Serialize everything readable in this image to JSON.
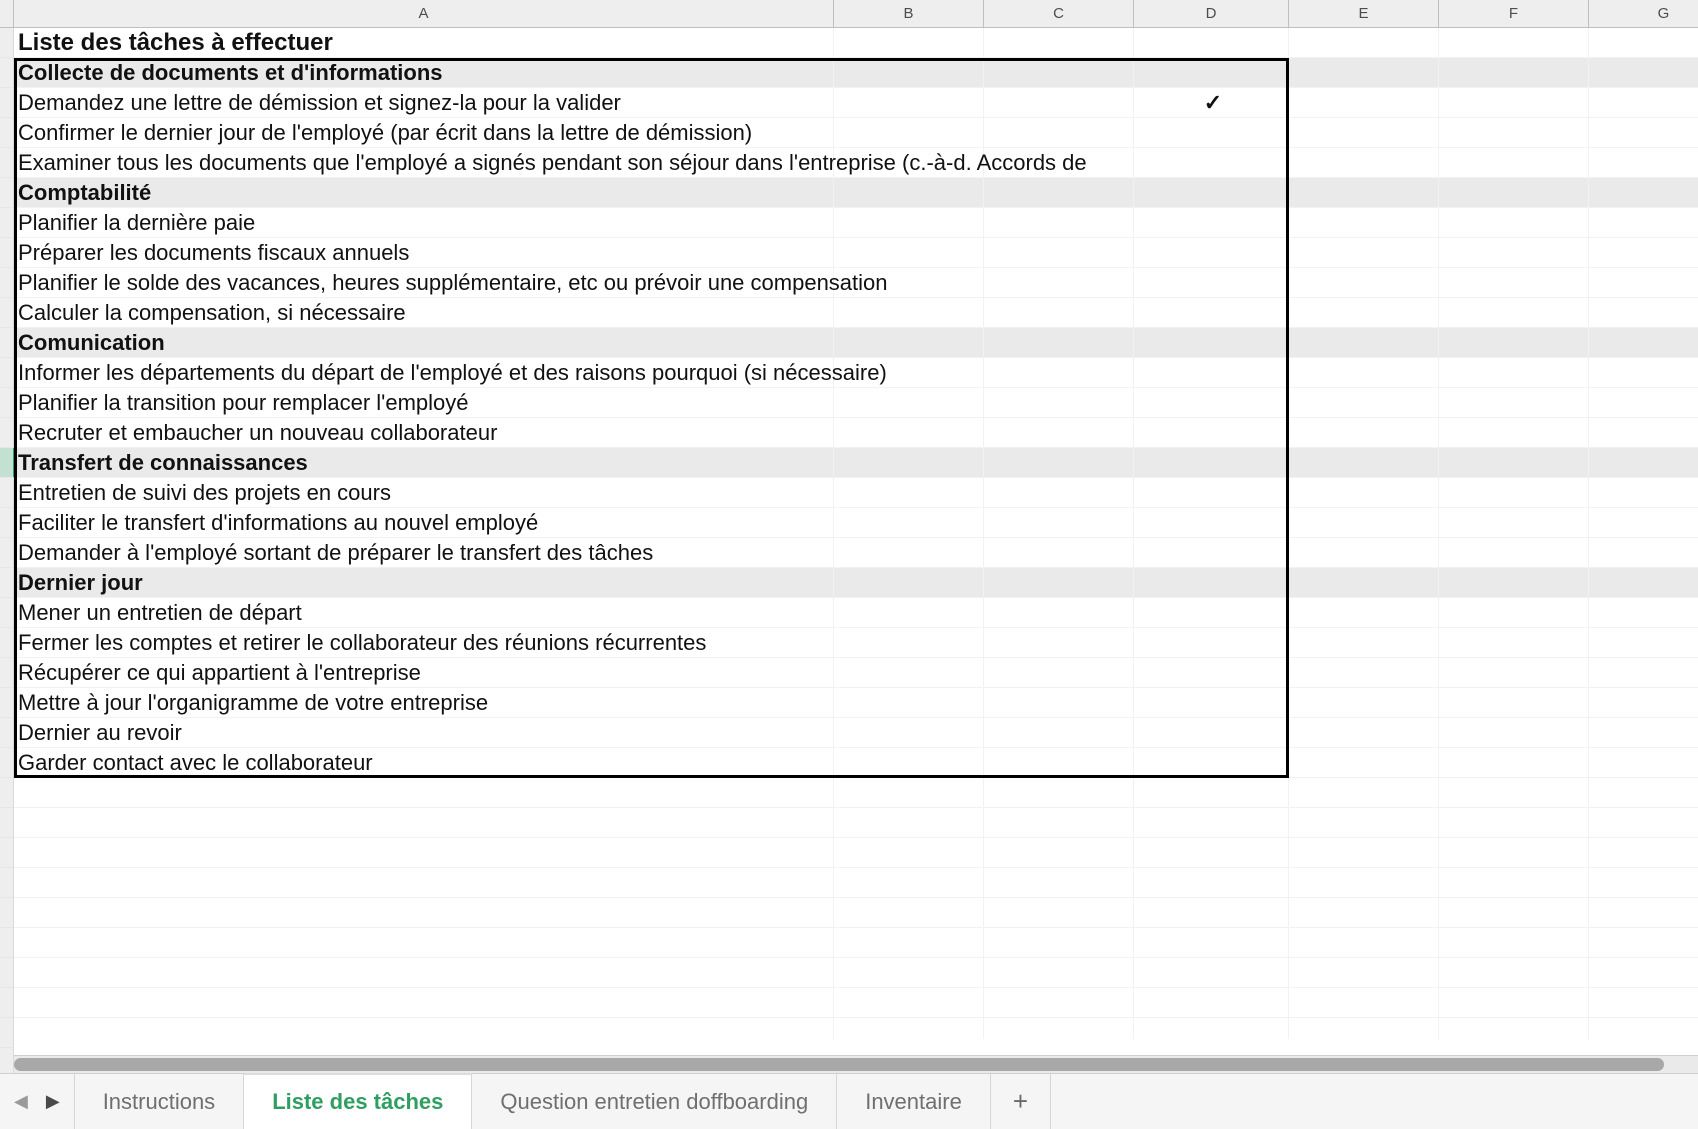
{
  "columns": [
    "A",
    "B",
    "C",
    "D",
    "E",
    "F",
    "G"
  ],
  "title": "Liste des tâches à effectuer",
  "checkmark_glyph": "✓",
  "sections": [
    {
      "heading": "Collecte de documents et d'informations",
      "tasks": [
        {
          "text": "Demandez une lettre de démission et signez-la pour la valider",
          "done": true
        },
        {
          "text": "Confirmer le dernier jour de l'employé (par écrit dans la lettre de démission)",
          "done": false
        },
        {
          "text": "Examiner tous les documents que l'employé a signés pendant son séjour dans l'entreprise (c.-à-d. Accords de",
          "done": false
        }
      ]
    },
    {
      "heading": "Comptabilité",
      "tasks": [
        {
          "text": "Planifier la dernière paie",
          "done": false
        },
        {
          "text": "Préparer les documents fiscaux annuels",
          "done": false
        },
        {
          "text": "Planifier le solde des vacances, heures supplémentaire, etc ou prévoir une compensation",
          "done": false
        },
        {
          "text": "Calculer la compensation, si nécessaire",
          "done": false
        }
      ]
    },
    {
      "heading": "Comunication",
      "tasks": [
        {
          "text": "Informer les départements du départ de l'employé et des raisons pourquoi (si nécessaire)",
          "done": false
        },
        {
          "text": "Planifier la transition pour remplacer l'employé",
          "done": false
        },
        {
          "text": "Recruter et embaucher un nouveau collaborateur",
          "done": false
        }
      ]
    },
    {
      "heading": "Transfert de connaissances",
      "tasks": [
        {
          "text": "Entretien de suivi des projets en cours",
          "done": false
        },
        {
          "text": "Faciliter le transfert d'informations au nouvel employé",
          "done": false
        },
        {
          "text": "Demander à l'employé sortant de préparer le transfert des tâches",
          "done": false
        }
      ]
    },
    {
      "heading": "Dernier jour",
      "tasks": [
        {
          "text": "Mener un entretien de départ",
          "done": false
        },
        {
          "text": "Fermer les comptes et retirer le collaborateur des réunions récurrentes",
          "done": false
        },
        {
          "text": "Récupérer ce qui appartient à l'entreprise",
          "done": false
        },
        {
          "text": "Mettre à jour l'organigramme de votre entreprise",
          "done": false
        },
        {
          "text": "Dernier au revoir",
          "done": false
        },
        {
          "text": "Garder contact avec le collaborateur",
          "done": false
        }
      ]
    }
  ],
  "selected_row_index": 15,
  "tabs": {
    "items": [
      {
        "label": "Instructions",
        "active": false
      },
      {
        "label": "Liste des tâches",
        "active": true
      },
      {
        "label": "Question entretien doffboarding",
        "active": false
      },
      {
        "label": "Inventaire",
        "active": false
      }
    ],
    "add_glyph": "+"
  },
  "nav": {
    "prev": "◀",
    "next": "▶"
  }
}
